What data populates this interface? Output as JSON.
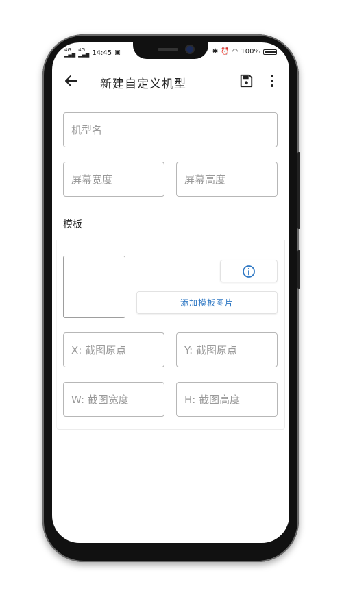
{
  "status_bar": {
    "network_1": "4G",
    "network_2": "4G",
    "time": "14:45",
    "battery": "100%"
  },
  "app_bar": {
    "title": "新建自定义机型",
    "back_icon": "arrow-left-icon",
    "save_icon": "floppy-disk-icon",
    "more_icon": "more-vert-icon"
  },
  "form": {
    "model_name": {
      "placeholder": "机型名",
      "value": ""
    },
    "screen_width": {
      "placeholder": "屏幕宽度",
      "value": ""
    },
    "screen_height": {
      "placeholder": "屏幕高度",
      "value": ""
    },
    "template_label": "模板",
    "info_icon": "info-circle-icon",
    "add_template_image_label": "添加模板图片",
    "crop_x": {
      "placeholder": "X: 截图原点",
      "value": ""
    },
    "crop_y": {
      "placeholder": "Y: 截图原点",
      "value": ""
    },
    "crop_w": {
      "placeholder": "W: 截图宽度",
      "value": ""
    },
    "crop_h": {
      "placeholder": "H: 截图高度",
      "value": ""
    }
  },
  "colors": {
    "accent": "#2f78c4",
    "field_border": "#b7b7b7",
    "placeholder": "#9a9a9a",
    "text": "#222222"
  }
}
